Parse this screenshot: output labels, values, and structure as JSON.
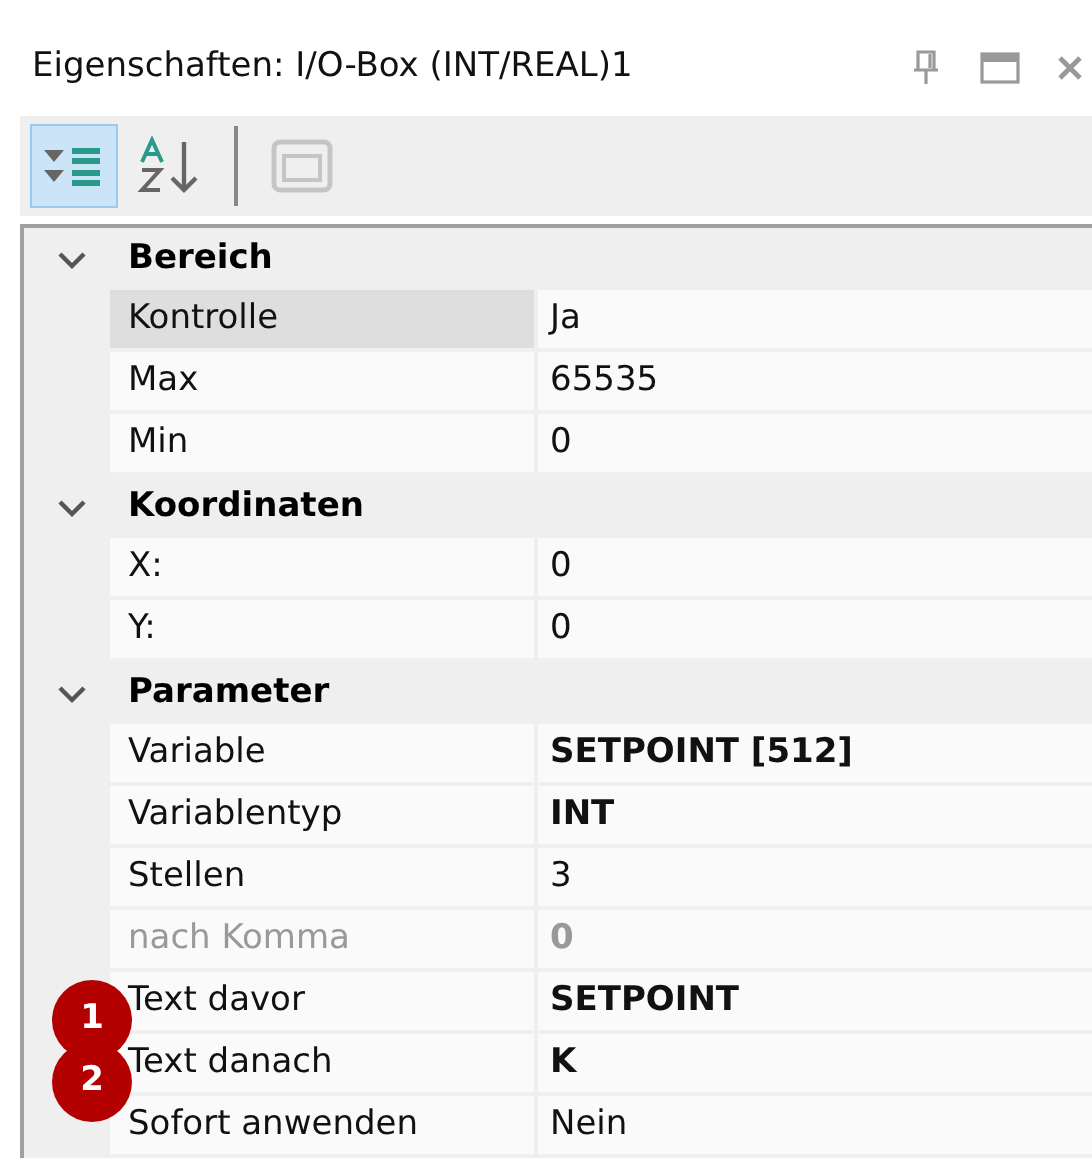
{
  "window": {
    "title": "Eigenschaften: I/O-Box (INT/REAL)1"
  },
  "toolbar": [
    {
      "kind": "categorized",
      "selected": true
    },
    {
      "kind": "alphabetical",
      "selected": false
    },
    {
      "kind": "pages",
      "selected": false,
      "disabled": true
    }
  ],
  "categories": [
    {
      "name": "Bereich",
      "expanded": true,
      "properties": [
        {
          "name": "Kontrolle",
          "value": "Ja",
          "bold": false,
          "disabled": false,
          "selected": true
        },
        {
          "name": "Max",
          "value": "65535",
          "bold": false,
          "disabled": false,
          "selected": false
        },
        {
          "name": "Min",
          "value": "0",
          "bold": false,
          "disabled": false,
          "selected": false
        }
      ]
    },
    {
      "name": "Koordinaten",
      "expanded": true,
      "properties": [
        {
          "name": "X:",
          "value": "0",
          "bold": false,
          "disabled": false,
          "selected": false
        },
        {
          "name": "Y:",
          "value": "0",
          "bold": false,
          "disabled": false,
          "selected": false
        }
      ]
    },
    {
      "name": "Parameter",
      "expanded": true,
      "properties": [
        {
          "name": "Variable",
          "value": "SETPOINT [512]",
          "bold": true,
          "disabled": false,
          "selected": false
        },
        {
          "name": "Variablentyp",
          "value": "INT",
          "bold": true,
          "disabled": false,
          "selected": false
        },
        {
          "name": "Stellen",
          "value": "3",
          "bold": false,
          "disabled": false,
          "selected": false
        },
        {
          "name": "nach Komma",
          "value": "0",
          "bold": true,
          "disabled": true,
          "selected": false
        },
        {
          "name": "Text davor",
          "value": "SETPOINT",
          "bold": true,
          "disabled": false,
          "selected": false,
          "badge": "1"
        },
        {
          "name": "Text danach",
          "value": "K",
          "bold": true,
          "disabled": false,
          "selected": false,
          "badge": "2"
        },
        {
          "name": "Sofort anwenden",
          "value": "Nein",
          "bold": false,
          "disabled": false,
          "selected": false
        }
      ]
    }
  ]
}
